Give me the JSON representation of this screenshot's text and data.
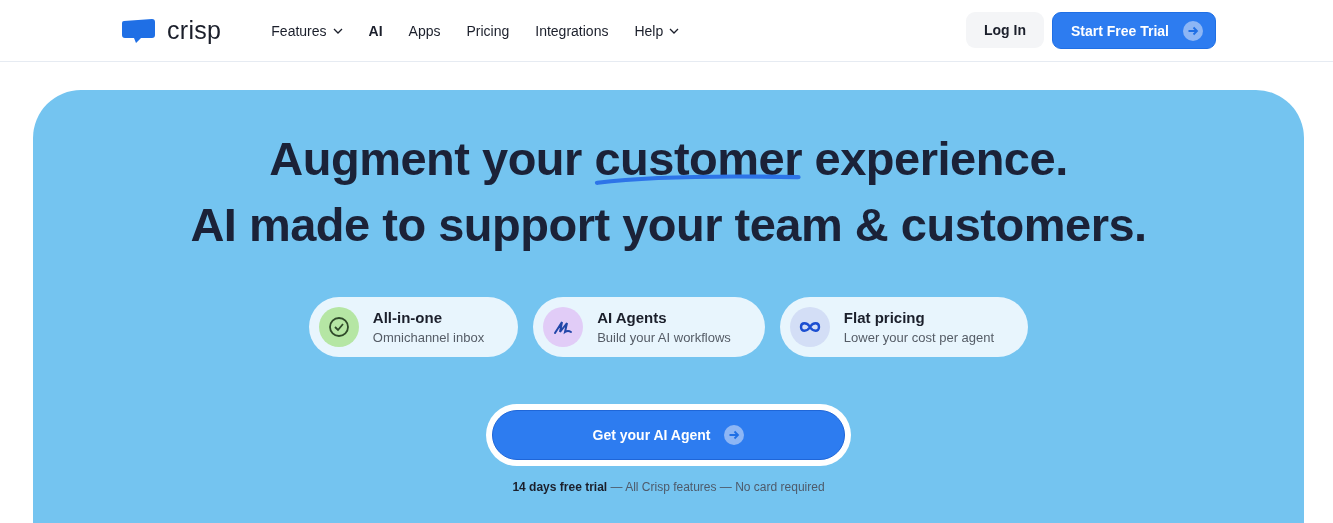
{
  "header": {
    "brand": "crisp",
    "nav": [
      {
        "label": "Features",
        "has_menu": true,
        "selected": false
      },
      {
        "label": "AI",
        "has_menu": false,
        "selected": true
      },
      {
        "label": "Apps",
        "has_menu": false,
        "selected": false
      },
      {
        "label": "Pricing",
        "has_menu": false,
        "selected": false
      },
      {
        "label": "Integrations",
        "has_menu": false,
        "selected": false
      },
      {
        "label": "Help",
        "has_menu": true,
        "selected": false
      }
    ],
    "login": "Log In",
    "trial": "Start Free Trial"
  },
  "hero": {
    "headline": [
      [
        {
          "text": "Augment your ",
          "underlined": false
        },
        {
          "text": "customer",
          "underlined": true
        },
        {
          "text": " experience.",
          "underlined": false
        }
      ],
      [
        {
          "text": "AI made to support your team & customers.",
          "underlined": false
        }
      ]
    ],
    "features": [
      {
        "kind": "check",
        "color": "#b5e6a4",
        "title": "All-in-one",
        "subtitle": "Omnichannel inbox"
      },
      {
        "kind": "scribble",
        "color": "#e1ccf7",
        "title": "AI Agents",
        "subtitle": "Build your AI workflows"
      },
      {
        "kind": "infinity",
        "color": "#d3def6",
        "title": "Flat pricing",
        "subtitle": "Lower your cost per agent"
      }
    ],
    "cta": "Get your AI Agent",
    "note": "**14 days free trial** — All Crisp features — No card required"
  }
}
